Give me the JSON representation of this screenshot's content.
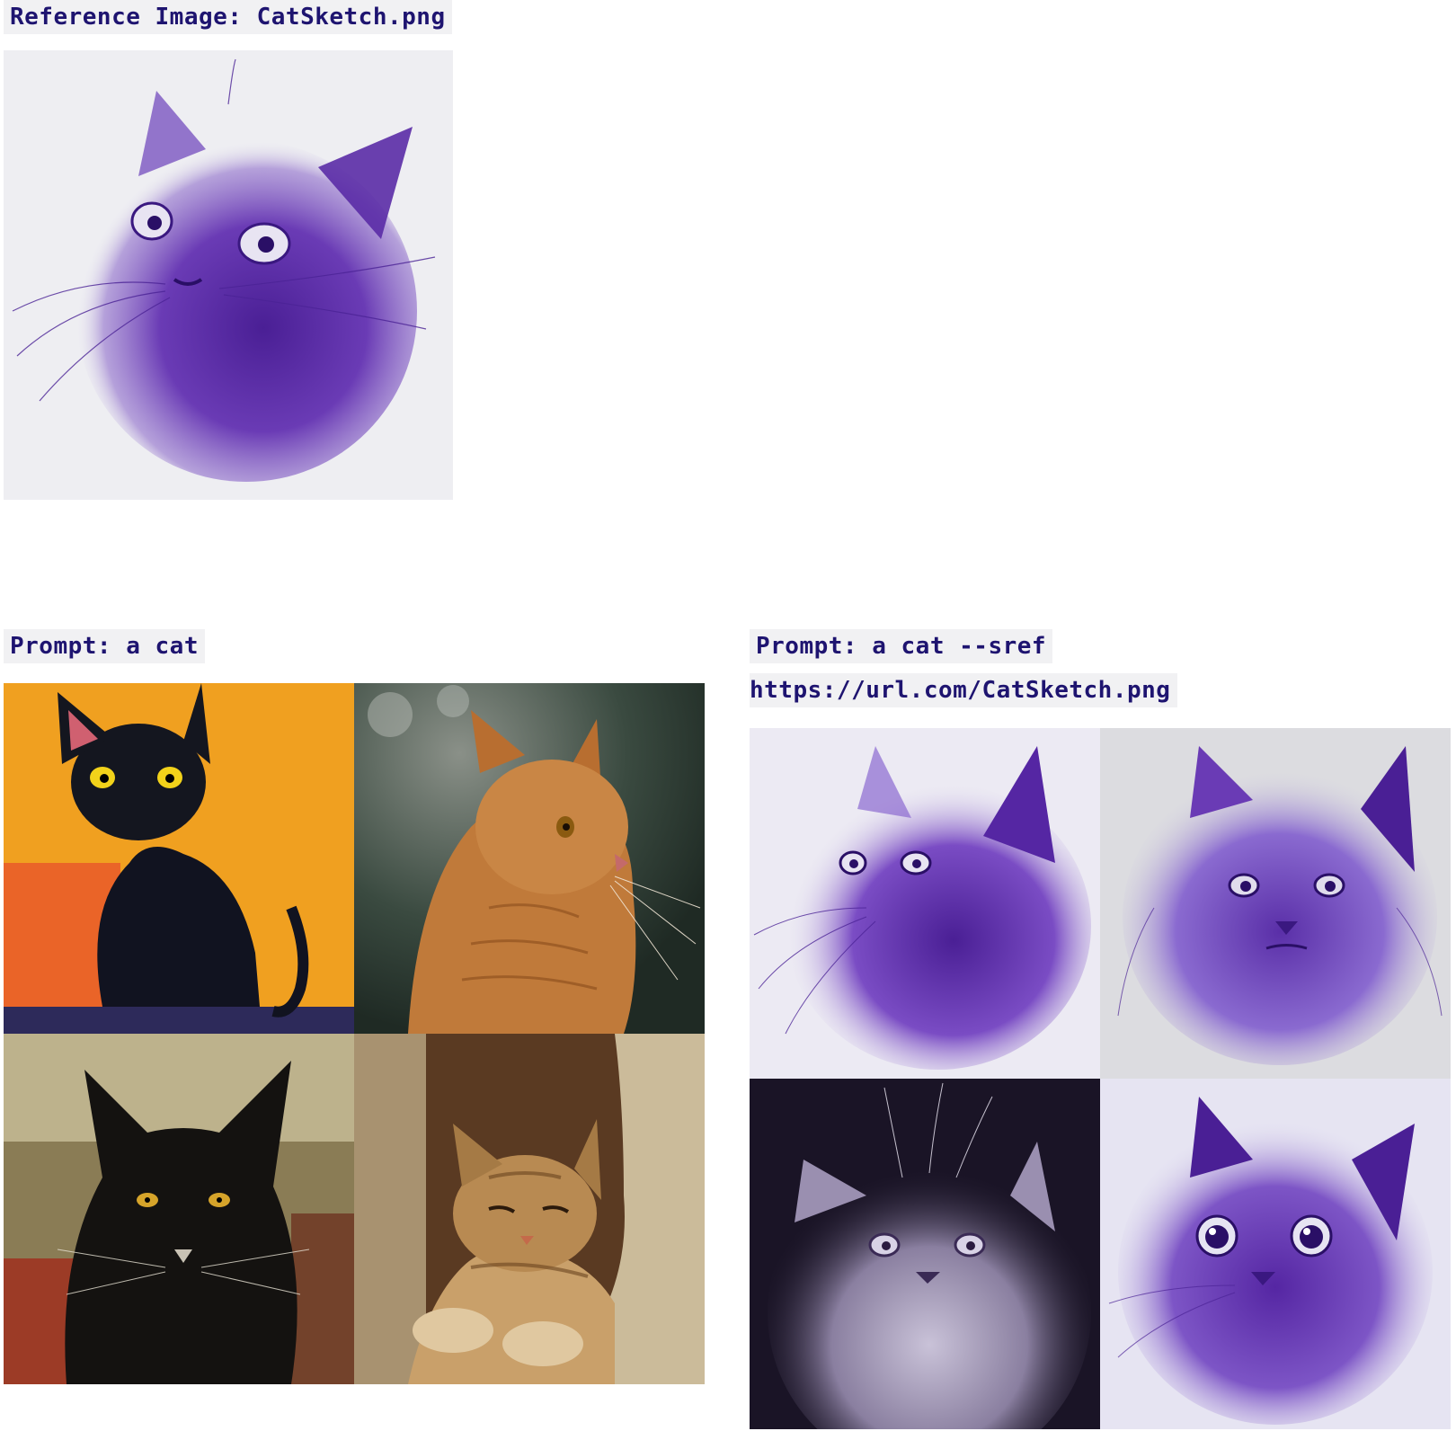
{
  "reference": {
    "label": "Reference Image: CatSketch.png"
  },
  "left_panel": {
    "label": "Prompt: a cat",
    "images": [
      {
        "icon": "black-cat-orange-background-painting"
      },
      {
        "icon": "ginger-tabby-cat-photo"
      },
      {
        "icon": "black-cat-textured-painting"
      },
      {
        "icon": "tabby-cat-in-tree-painting"
      }
    ]
  },
  "right_panel": {
    "label_line1": "Prompt: a cat --sref",
    "label_line2": "https://url.com/CatSketch.png",
    "images": [
      {
        "icon": "purple-sketch-persian-cat"
      },
      {
        "icon": "purple-sketch-grumpy-cat"
      },
      {
        "icon": "white-sketch-cat-dark-background"
      },
      {
        "icon": "purple-sketch-wide-eyed-cat"
      }
    ]
  },
  "colors": {
    "label_text": "#1e1470",
    "label_bg": "#f1f1f3",
    "sketch_purple": "#5b2fa8"
  }
}
